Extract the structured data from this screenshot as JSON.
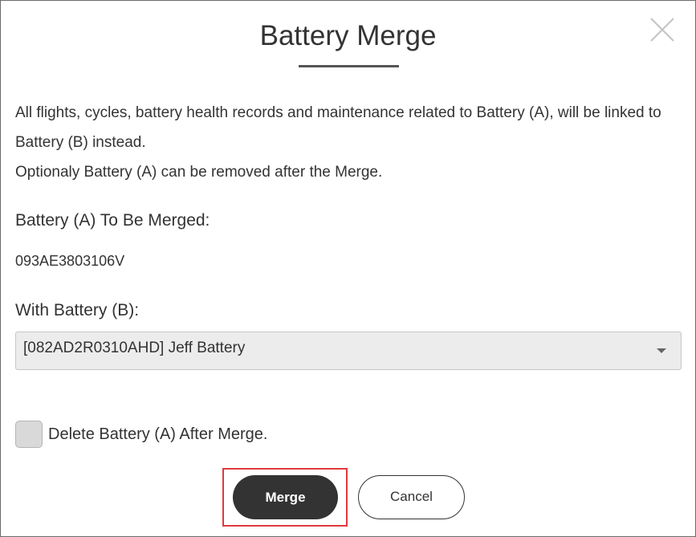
{
  "dialog": {
    "title": "Battery Merge",
    "close_icon": "close-icon",
    "description": [
      "All flights, cycles, battery health records and maintenance related to Battery (A), will be linked to Battery (B) instead.",
      "Optionaly Battery (A) can be removed after the Merge."
    ],
    "battery_a": {
      "label": "Battery (A) To Be Merged:",
      "value": "093AE3803106V"
    },
    "battery_b": {
      "label": "With Battery (B):",
      "selected": "[082AD2R0310AHD] Jeff Battery",
      "caret_icon": "caret-down-icon"
    },
    "delete_option": {
      "label": "Delete Battery (A) After Merge.",
      "checked": false
    },
    "buttons": {
      "merge": "Merge",
      "cancel": "Cancel"
    }
  },
  "colors": {
    "primary_button": "#333333",
    "highlight": "#e0393e",
    "select_bg": "#ececec"
  }
}
